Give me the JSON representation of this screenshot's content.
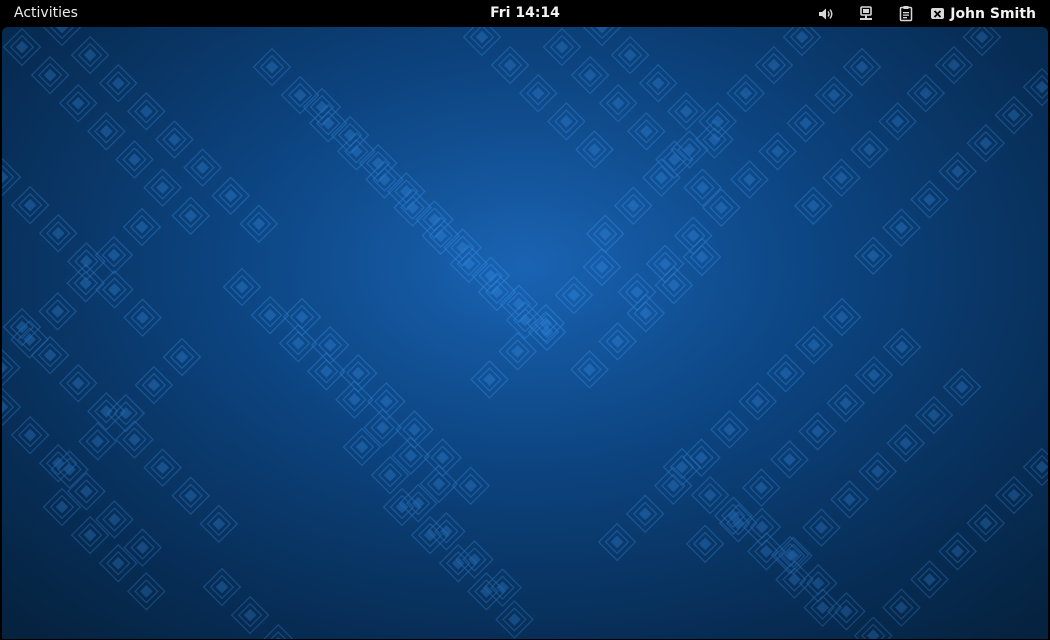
{
  "topbar": {
    "activities_label": "Activities",
    "clock": "Fri 14:14",
    "user_name": "John Smith",
    "icons": [
      "volume-icon",
      "network-icon",
      "clipboard-icon",
      "user-status-icon"
    ]
  },
  "desktop": {
    "wallpaper": "blue geometric pattern",
    "colors": {
      "background": "#0e4f95",
      "pattern": "#2a7fd6",
      "topbar": "#000000"
    }
  }
}
